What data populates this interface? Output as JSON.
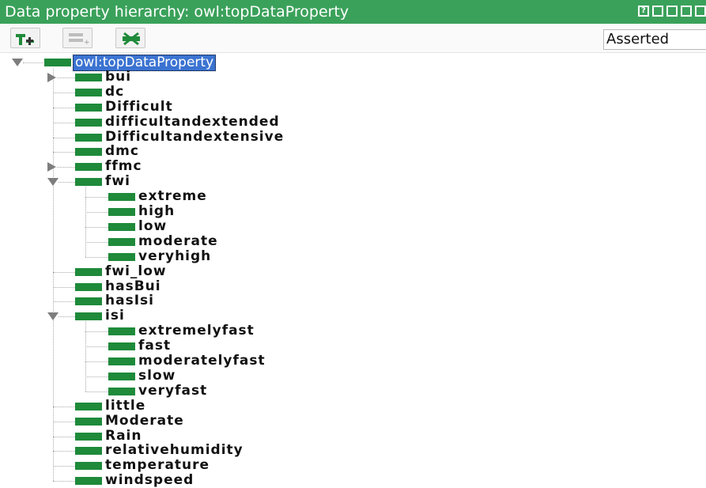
{
  "view": {
    "title": "Data property hierarchy: owl:topDataProperty",
    "display_mode": "Asserted"
  },
  "toolbar": {
    "buttons": [
      {
        "icon": "add-subproperty-icon"
      },
      {
        "icon": "add-sibling-property-icon"
      },
      {
        "icon": "delete-property-icon"
      }
    ]
  },
  "tree": {
    "root": {
      "label": "owl:topDataProperty",
      "selected": true,
      "state": "expanded"
    },
    "nodes": [
      {
        "label": "bui",
        "depth": 1,
        "state": "collapsed"
      },
      {
        "label": "dc",
        "depth": 1,
        "state": "leaf"
      },
      {
        "label": "Difficult",
        "depth": 1,
        "state": "leaf"
      },
      {
        "label": "difficultandextended",
        "depth": 1,
        "state": "leaf"
      },
      {
        "label": "Difficultandextensive",
        "depth": 1,
        "state": "leaf"
      },
      {
        "label": "dmc",
        "depth": 1,
        "state": "leaf"
      },
      {
        "label": "ffmc",
        "depth": 1,
        "state": "collapsed"
      },
      {
        "label": "fwi",
        "depth": 1,
        "state": "expanded"
      },
      {
        "label": "extreme",
        "depth": 2,
        "state": "leaf"
      },
      {
        "label": "high",
        "depth": 2,
        "state": "leaf"
      },
      {
        "label": "low",
        "depth": 2,
        "state": "leaf"
      },
      {
        "label": "moderate",
        "depth": 2,
        "state": "leaf"
      },
      {
        "label": "veryhigh",
        "depth": 2,
        "state": "leaf"
      },
      {
        "label": "fwi_low",
        "depth": 1,
        "state": "leaf"
      },
      {
        "label": "hasBui",
        "depth": 1,
        "state": "leaf"
      },
      {
        "label": "hasIsi",
        "depth": 1,
        "state": "leaf"
      },
      {
        "label": "isi",
        "depth": 1,
        "state": "expanded"
      },
      {
        "label": "extremelyfast",
        "depth": 2,
        "state": "leaf"
      },
      {
        "label": "fast",
        "depth": 2,
        "state": "leaf"
      },
      {
        "label": "moderatelyfast",
        "depth": 2,
        "state": "leaf"
      },
      {
        "label": "slow",
        "depth": 2,
        "state": "leaf"
      },
      {
        "label": "veryfast",
        "depth": 2,
        "state": "leaf"
      },
      {
        "label": "little",
        "depth": 1,
        "state": "leaf"
      },
      {
        "label": "Moderate",
        "depth": 1,
        "state": "leaf"
      },
      {
        "label": "Rain",
        "depth": 1,
        "state": "leaf"
      },
      {
        "label": "relativehumidity",
        "depth": 1,
        "state": "leaf"
      },
      {
        "label": "temperature",
        "depth": 1,
        "state": "leaf"
      },
      {
        "label": "windspeed",
        "depth": 1,
        "state": "leaf"
      }
    ]
  },
  "colors": {
    "title_bar": "#3aa15a",
    "property_icon": "#1e8a3a",
    "selection": "#3b73d1"
  }
}
